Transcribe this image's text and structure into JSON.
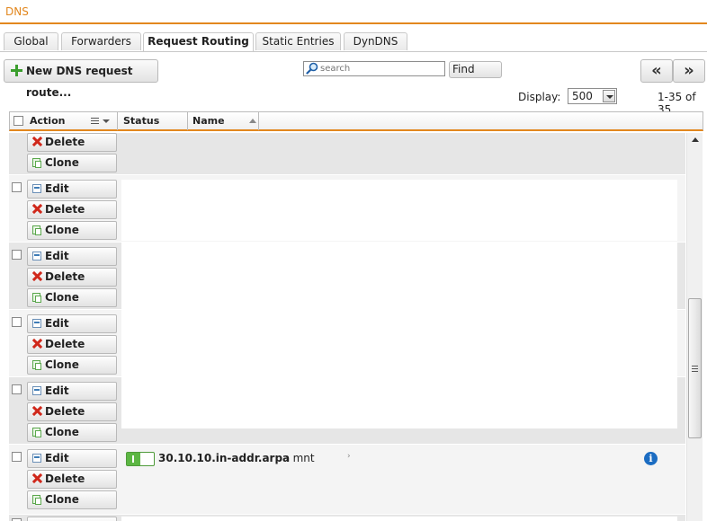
{
  "header": {
    "title": "DNS"
  },
  "tabs": [
    {
      "label": "Global",
      "active": false
    },
    {
      "label": "Forwarders",
      "active": false
    },
    {
      "label": "Request Routing",
      "active": true
    },
    {
      "label": "Static Entries",
      "active": false
    },
    {
      "label": "DynDNS",
      "active": false
    }
  ],
  "toolbar": {
    "new_route_label": "New DNS request route...",
    "search_placeholder": "search",
    "find_label": "Find",
    "prev_label": "«",
    "next_label": "»"
  },
  "pagination": {
    "display_label": "Display:",
    "display_value": "500",
    "range_text": "1-35 of 35"
  },
  "grid": {
    "columns": {
      "action": "Action",
      "status": "Status",
      "name": "Name"
    },
    "action_labels": {
      "edit": "Edit",
      "delete": "Delete",
      "clone": "Clone"
    },
    "visible_row": {
      "name": "30.10.10.in-addr.arpa",
      "target": "› mnt",
      "target_end": "›"
    }
  },
  "colors": {
    "accent": "#e2871e",
    "status_on": "#5cb643",
    "info": "#1b6cc2",
    "delete": "#d0281b"
  }
}
